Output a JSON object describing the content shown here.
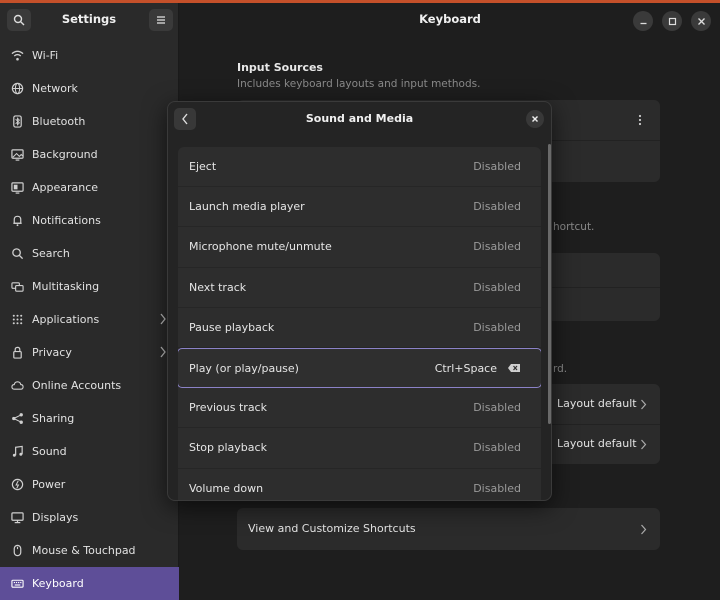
{
  "sidebar": {
    "title": "Settings",
    "items": [
      {
        "label": "Wi-Fi",
        "icon": "wifi-icon"
      },
      {
        "label": "Network",
        "icon": "network-icon"
      },
      {
        "label": "Bluetooth",
        "icon": "bluetooth-icon"
      },
      {
        "label": "Background",
        "icon": "background-icon"
      },
      {
        "label": "Appearance",
        "icon": "appearance-icon"
      },
      {
        "label": "Notifications",
        "icon": "bell-icon"
      },
      {
        "label": "Search",
        "icon": "search-icon"
      },
      {
        "label": "Multitasking",
        "icon": "multitasking-icon"
      },
      {
        "label": "Applications",
        "icon": "grid-icon"
      },
      {
        "label": "Privacy",
        "icon": "hand-icon"
      },
      {
        "label": "Online Accounts",
        "icon": "cloud-icon"
      },
      {
        "label": "Sharing",
        "icon": "share-icon"
      },
      {
        "label": "Sound",
        "icon": "music-note-icon"
      },
      {
        "label": "Power",
        "icon": "power-icon"
      },
      {
        "label": "Displays",
        "icon": "display-icon"
      },
      {
        "label": "Mouse & Touchpad",
        "icon": "mouse-icon"
      },
      {
        "label": "Keyboard",
        "icon": "keyboard-icon"
      }
    ],
    "active": "Keyboard"
  },
  "main": {
    "title": "Keyboard",
    "input_sources": {
      "title": "Input Sources",
      "subtitle": "Includes keyboard layouts and input methods."
    },
    "peek_text": "hortcut.",
    "peek_text2": "rd.",
    "layout_default_1": "Layout default",
    "layout_default_2": "Layout default",
    "view_customize": "View and Customize Shortcuts"
  },
  "dialog": {
    "title": "Sound and Media",
    "rows": [
      {
        "label": "Eject",
        "value": "Disabled"
      },
      {
        "label": "Launch media player",
        "value": "Disabled"
      },
      {
        "label": "Microphone mute/unmute",
        "value": "Disabled"
      },
      {
        "label": "Next track",
        "value": "Disabled"
      },
      {
        "label": "Pause playback",
        "value": "Disabled"
      },
      {
        "label": "Play (or play/pause)",
        "value": "Ctrl+Space",
        "selected": true
      },
      {
        "label": "Previous track",
        "value": "Disabled"
      },
      {
        "label": "Stop playback",
        "value": "Disabled"
      },
      {
        "label": "Volume down",
        "value": "Disabled"
      }
    ]
  },
  "colors": {
    "accent": "#5e4e98",
    "selection_border": "#8b82c7",
    "title_bar_accent": "#c4502a"
  }
}
